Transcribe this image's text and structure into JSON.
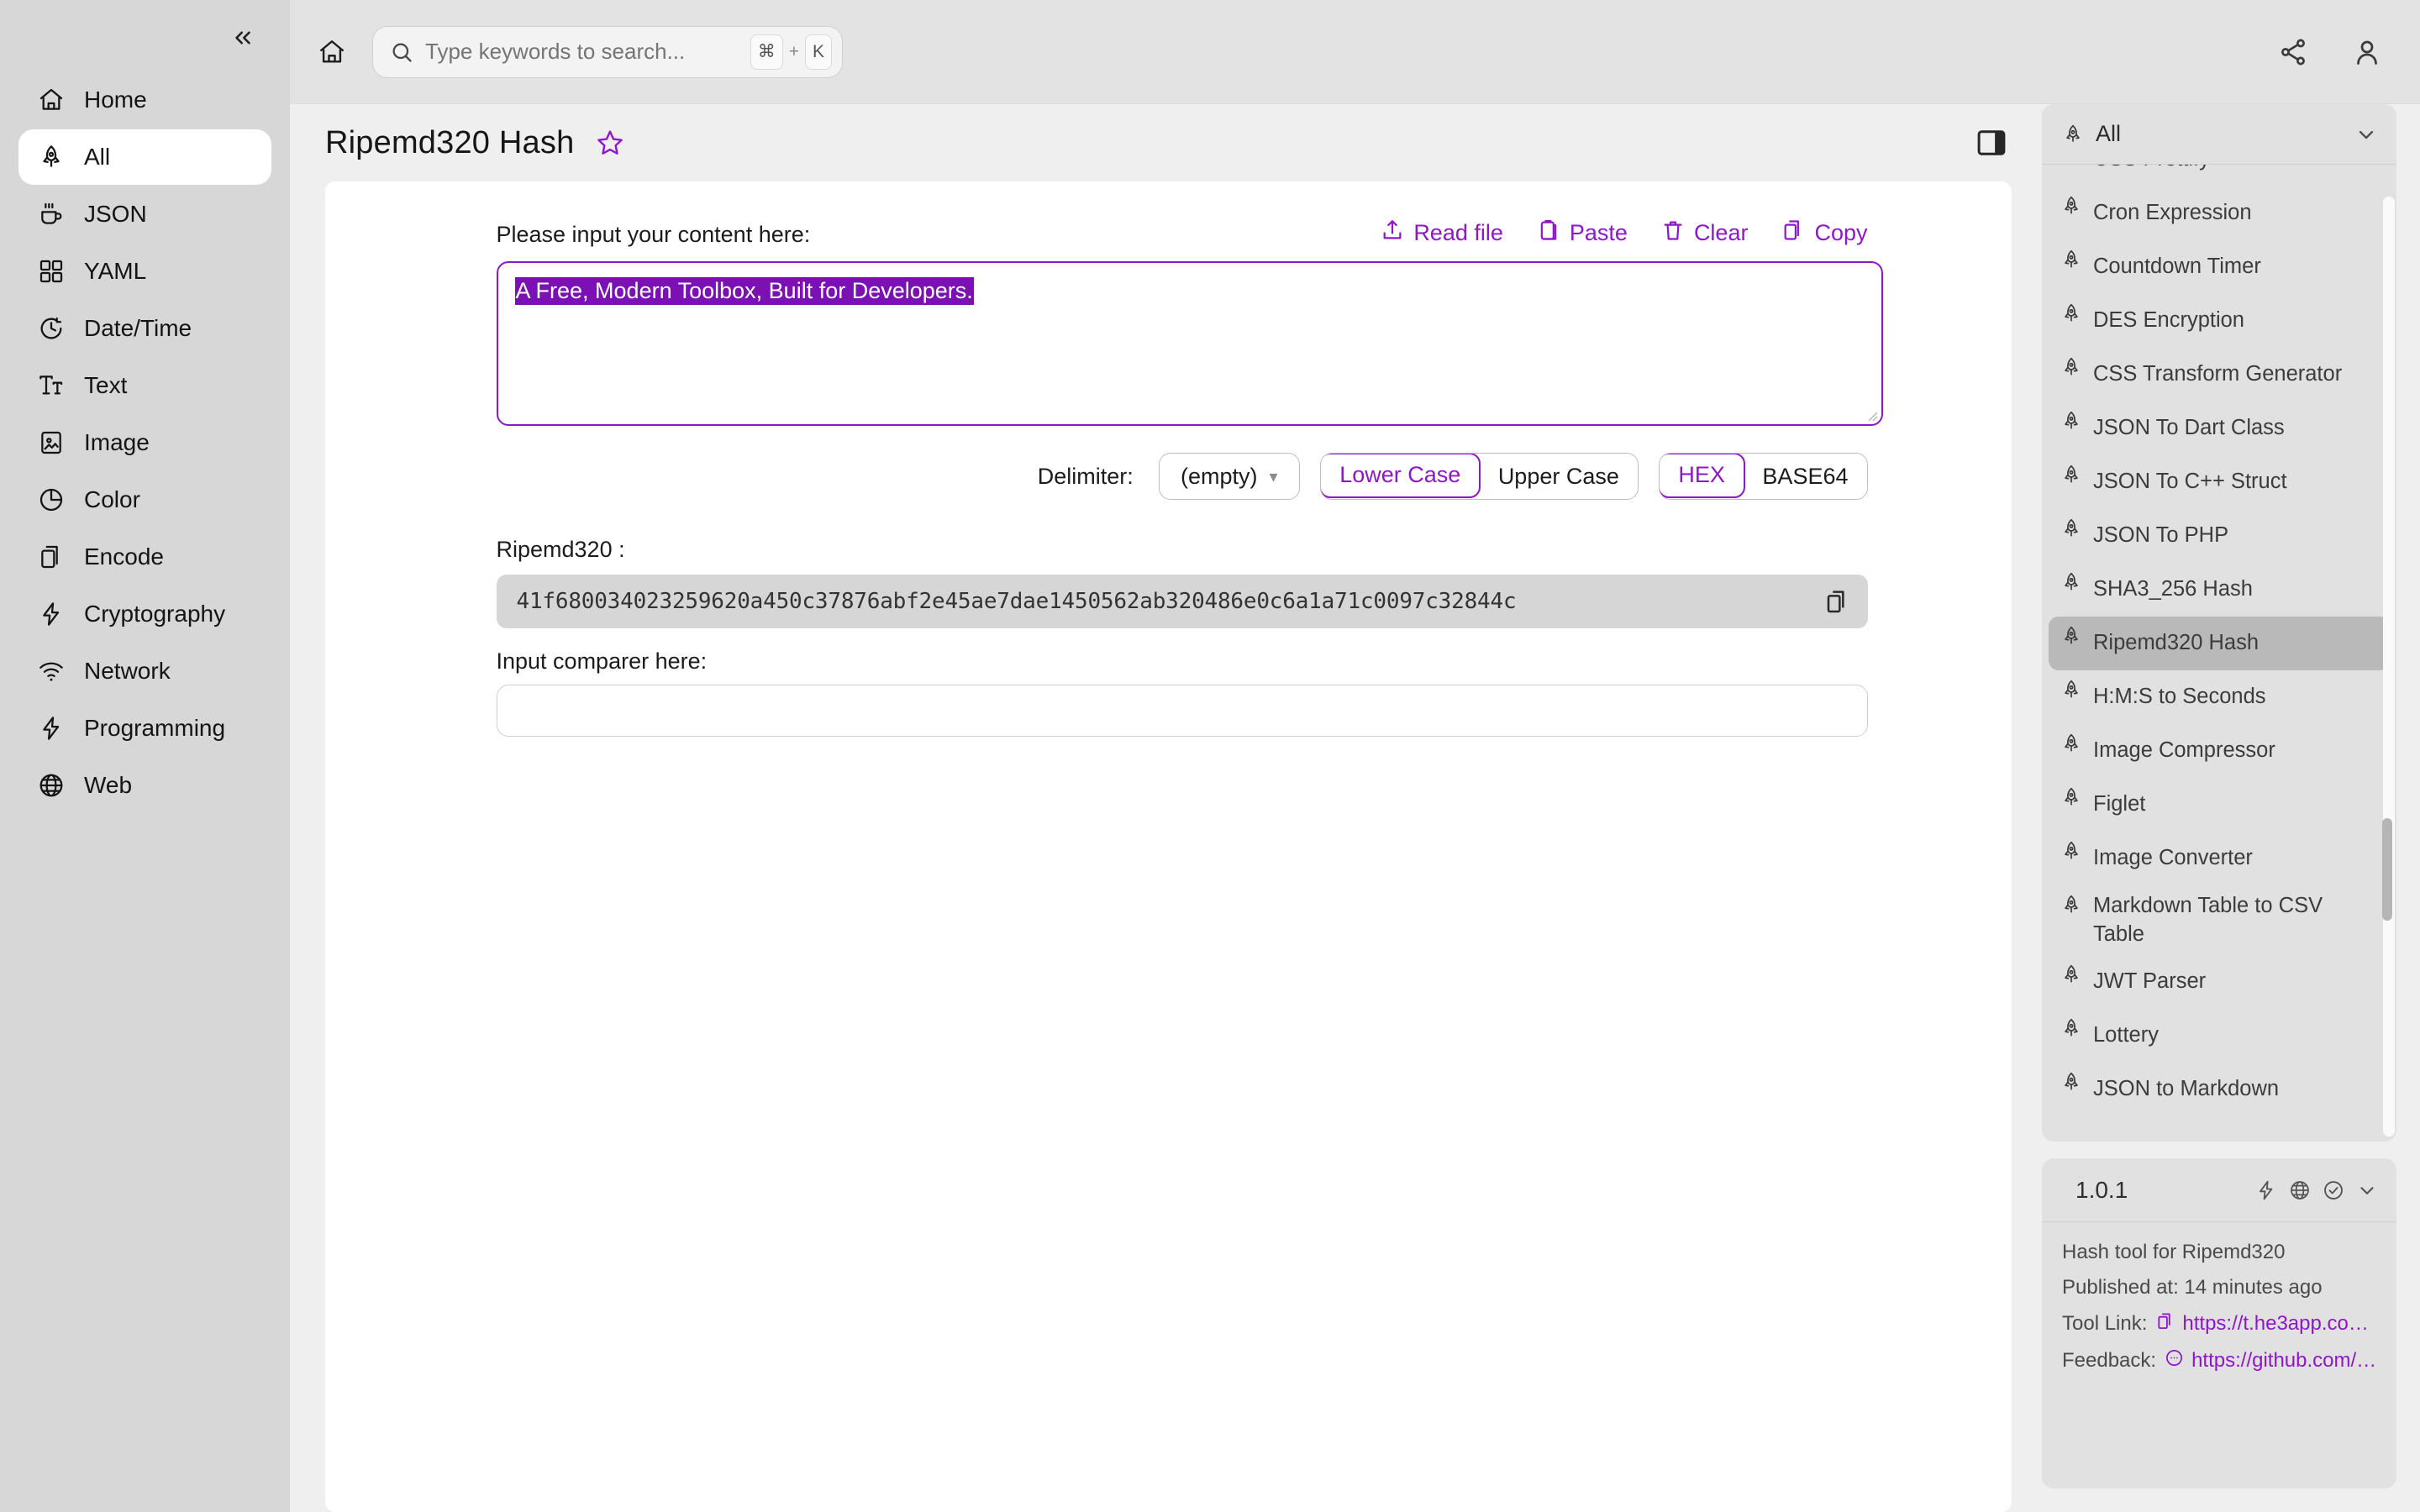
{
  "sidebar": {
    "collapse_icon": "chevrons-left-icon",
    "items": [
      {
        "label": "Home",
        "icon": "home-icon",
        "active": false
      },
      {
        "label": "All",
        "icon": "rocket-icon",
        "active": true
      },
      {
        "label": "JSON",
        "icon": "coffee-icon",
        "active": false
      },
      {
        "label": "YAML",
        "icon": "grid-icon",
        "active": false
      },
      {
        "label": "Date/Time",
        "icon": "clock-icon",
        "active": false
      },
      {
        "label": "Text",
        "icon": "text-icon",
        "active": false
      },
      {
        "label": "Image",
        "icon": "image-icon",
        "active": false
      },
      {
        "label": "Color",
        "icon": "pie-chart-icon",
        "active": false
      },
      {
        "label": "Encode",
        "icon": "copy-icon",
        "active": false
      },
      {
        "label": "Cryptography",
        "icon": "bolt-icon",
        "active": false
      },
      {
        "label": "Network",
        "icon": "wifi-icon",
        "active": false
      },
      {
        "label": "Programming",
        "icon": "bolt-icon",
        "active": false
      },
      {
        "label": "Web",
        "icon": "globe-icon",
        "active": false
      }
    ]
  },
  "header": {
    "home_icon": "home-icon",
    "search": {
      "placeholder": "Type keywords to search...",
      "value": "",
      "icon": "search-icon",
      "shortcut_key": "⌘",
      "shortcut_plus": "+",
      "shortcut_letter": "K"
    },
    "share_icon": "share-icon",
    "account_icon": "user-icon"
  },
  "page": {
    "title": "Ripemd320 Hash",
    "star_icon": "star-outline-icon",
    "panel_toggle_icon": "right-panel-toggle-icon"
  },
  "tool": {
    "input_label": "Please input your content here:",
    "actions": [
      {
        "label": "Read file",
        "icon": "upload-icon"
      },
      {
        "label": "Paste",
        "icon": "clipboard-icon"
      },
      {
        "label": "Clear",
        "icon": "trash-icon"
      },
      {
        "label": "Copy",
        "icon": "copy-icon"
      }
    ],
    "input_value": "A Free, Modern Toolbox, Built for Developers.",
    "input_selected": true,
    "delimiter_label": "Delimiter:",
    "delimiter_value": "(empty)",
    "case_options": [
      {
        "label": "Lower Case",
        "selected": true
      },
      {
        "label": "Upper Case",
        "selected": false
      }
    ],
    "encoding_options": [
      {
        "label": "HEX",
        "selected": true
      },
      {
        "label": "BASE64",
        "selected": false
      }
    ],
    "result_label": "Ripemd320 :",
    "result_value": "41f680034023259620a450c37876abf2e45ae7dae1450562ab320486e0c6a1a71c0097c32844c",
    "result_copy_icon": "copy-icon",
    "comparer_label": "Input comparer here:",
    "comparer_value": "",
    "comparer_placeholder": ""
  },
  "right_panel": {
    "filter": {
      "label": "All",
      "icon": "rocket-icon",
      "chevron": "chevron-down-icon"
    },
    "tools": [
      {
        "label": "CSS Prettify",
        "selected": false
      },
      {
        "label": "Cron Expression",
        "selected": false
      },
      {
        "label": "Countdown Timer",
        "selected": false
      },
      {
        "label": "DES Encryption",
        "selected": false
      },
      {
        "label": "CSS Transform Generator",
        "selected": false
      },
      {
        "label": "JSON To Dart Class",
        "selected": false
      },
      {
        "label": "JSON To C++ Struct",
        "selected": false
      },
      {
        "label": "JSON To PHP",
        "selected": false
      },
      {
        "label": "SHA3_256 Hash",
        "selected": false
      },
      {
        "label": "Ripemd320 Hash",
        "selected": true
      },
      {
        "label": "H:M:S to Seconds",
        "selected": false
      },
      {
        "label": "Image Compressor",
        "selected": false
      },
      {
        "label": "Figlet",
        "selected": false
      },
      {
        "label": "Image Converter",
        "selected": false
      },
      {
        "label": "Markdown Table to CSV Table",
        "selected": false
      },
      {
        "label": "JWT Parser",
        "selected": false
      },
      {
        "label": "Lottery",
        "selected": false
      },
      {
        "label": "JSON to Markdown",
        "selected": false
      }
    ],
    "info": {
      "info_icon": "info-circle-icon",
      "version": "1.0.1",
      "head_icons": [
        "bolt-icon",
        "globe-icon",
        "check-circle-icon",
        "chevron-down-icon"
      ],
      "description": "Hash tool for Ripemd320",
      "published": "Published at: 14 minutes ago",
      "tool_link_label": "Tool Link:",
      "tool_link_value": "https://t.he3app.co…",
      "tool_link_icon": "copy-icon",
      "feedback_label": "Feedback:",
      "feedback_value": "https://github.com/…",
      "feedback_icon": "message-icon"
    }
  },
  "colors": {
    "accent": "#8e17c9",
    "selection": "#7b10b5",
    "sidebar_bg": "#d7d7d7",
    "panel_bg": "#e1e1e1"
  }
}
